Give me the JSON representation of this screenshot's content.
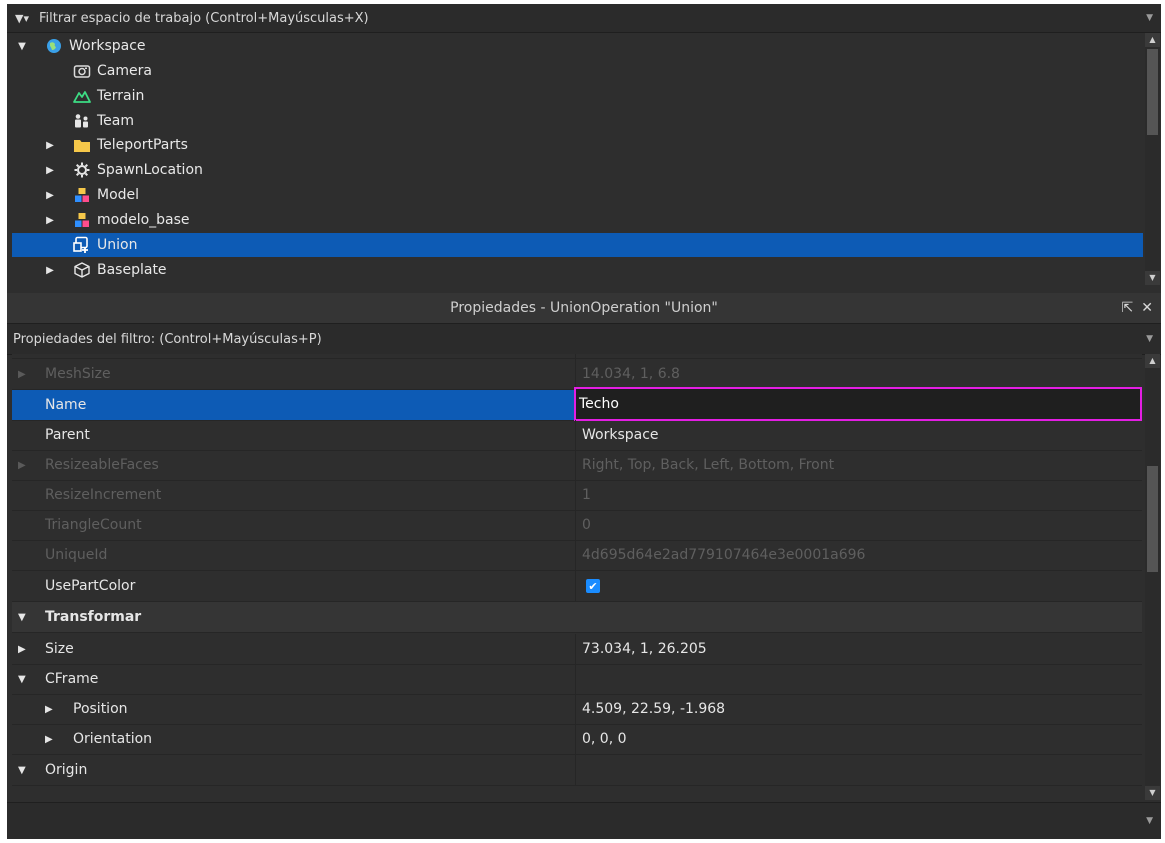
{
  "explorer": {
    "filter_placeholder": "Filtrar espacio de trabajo (Control+Mayúsculas+X)",
    "items": [
      {
        "label": "Workspace",
        "icon": "globe-icon",
        "caret": "▼"
      },
      {
        "label": "Camera",
        "icon": "camera-icon",
        "caret": ""
      },
      {
        "label": "Terrain",
        "icon": "terrain-icon",
        "caret": ""
      },
      {
        "label": "Team",
        "icon": "team-icon",
        "caret": ""
      },
      {
        "label": "TeleportParts",
        "icon": "folder-icon",
        "caret": "▶"
      },
      {
        "label": "SpawnLocation",
        "icon": "spawn-icon",
        "caret": "▶"
      },
      {
        "label": "Model",
        "icon": "model-icon",
        "caret": "▶"
      },
      {
        "label": "modelo_base",
        "icon": "model-icon",
        "caret": "▶"
      },
      {
        "label": "Union",
        "icon": "union-icon",
        "caret": ""
      },
      {
        "label": "Baseplate",
        "icon": "baseplate-icon",
        "caret": "▶"
      }
    ]
  },
  "properties": {
    "title": "Propiedades - UnionOperation \"Union\"",
    "filter_placeholder": "Propiedades del filtro: (Control+Mayúsculas+P)",
    "rows": [
      {
        "name": "MeshSize",
        "value": "14.034, 1, 6.8",
        "caret": "▶"
      },
      {
        "name": "Name",
        "value": "Techo",
        "caret": ""
      },
      {
        "name": "Parent",
        "value": "Workspace",
        "caret": ""
      },
      {
        "name": "ResizeableFaces",
        "value": "Right, Top, Back, Left, Bottom, Front",
        "caret": "▶"
      },
      {
        "name": "ResizeIncrement",
        "value": "1",
        "caret": ""
      },
      {
        "name": "TriangleCount",
        "value": "0",
        "caret": ""
      },
      {
        "name": "UniqueId",
        "value": "4d695d64e2ad779107464e3e0001a696",
        "caret": ""
      },
      {
        "name": "UsePartColor",
        "value": "",
        "caret": ""
      },
      {
        "name": "Transformar",
        "value": "",
        "caret": "▼"
      },
      {
        "name": "Size",
        "value": "73.034, 1, 26.205",
        "caret": "▶"
      },
      {
        "name": "CFrame",
        "value": "",
        "caret": "▼"
      },
      {
        "name": "Position",
        "value": "4.509, 22.59, -1.968",
        "caret": "▶"
      },
      {
        "name": "Orientation",
        "value": "0, 0, 0",
        "caret": "▶"
      },
      {
        "name": "Origin",
        "value": "",
        "caret": "▼"
      }
    ],
    "use_part_color_checked": true
  },
  "colors": {
    "selection": "#0d5bb5",
    "highlight_box": "#e31ee3",
    "checkbox": "#1a8cff"
  }
}
